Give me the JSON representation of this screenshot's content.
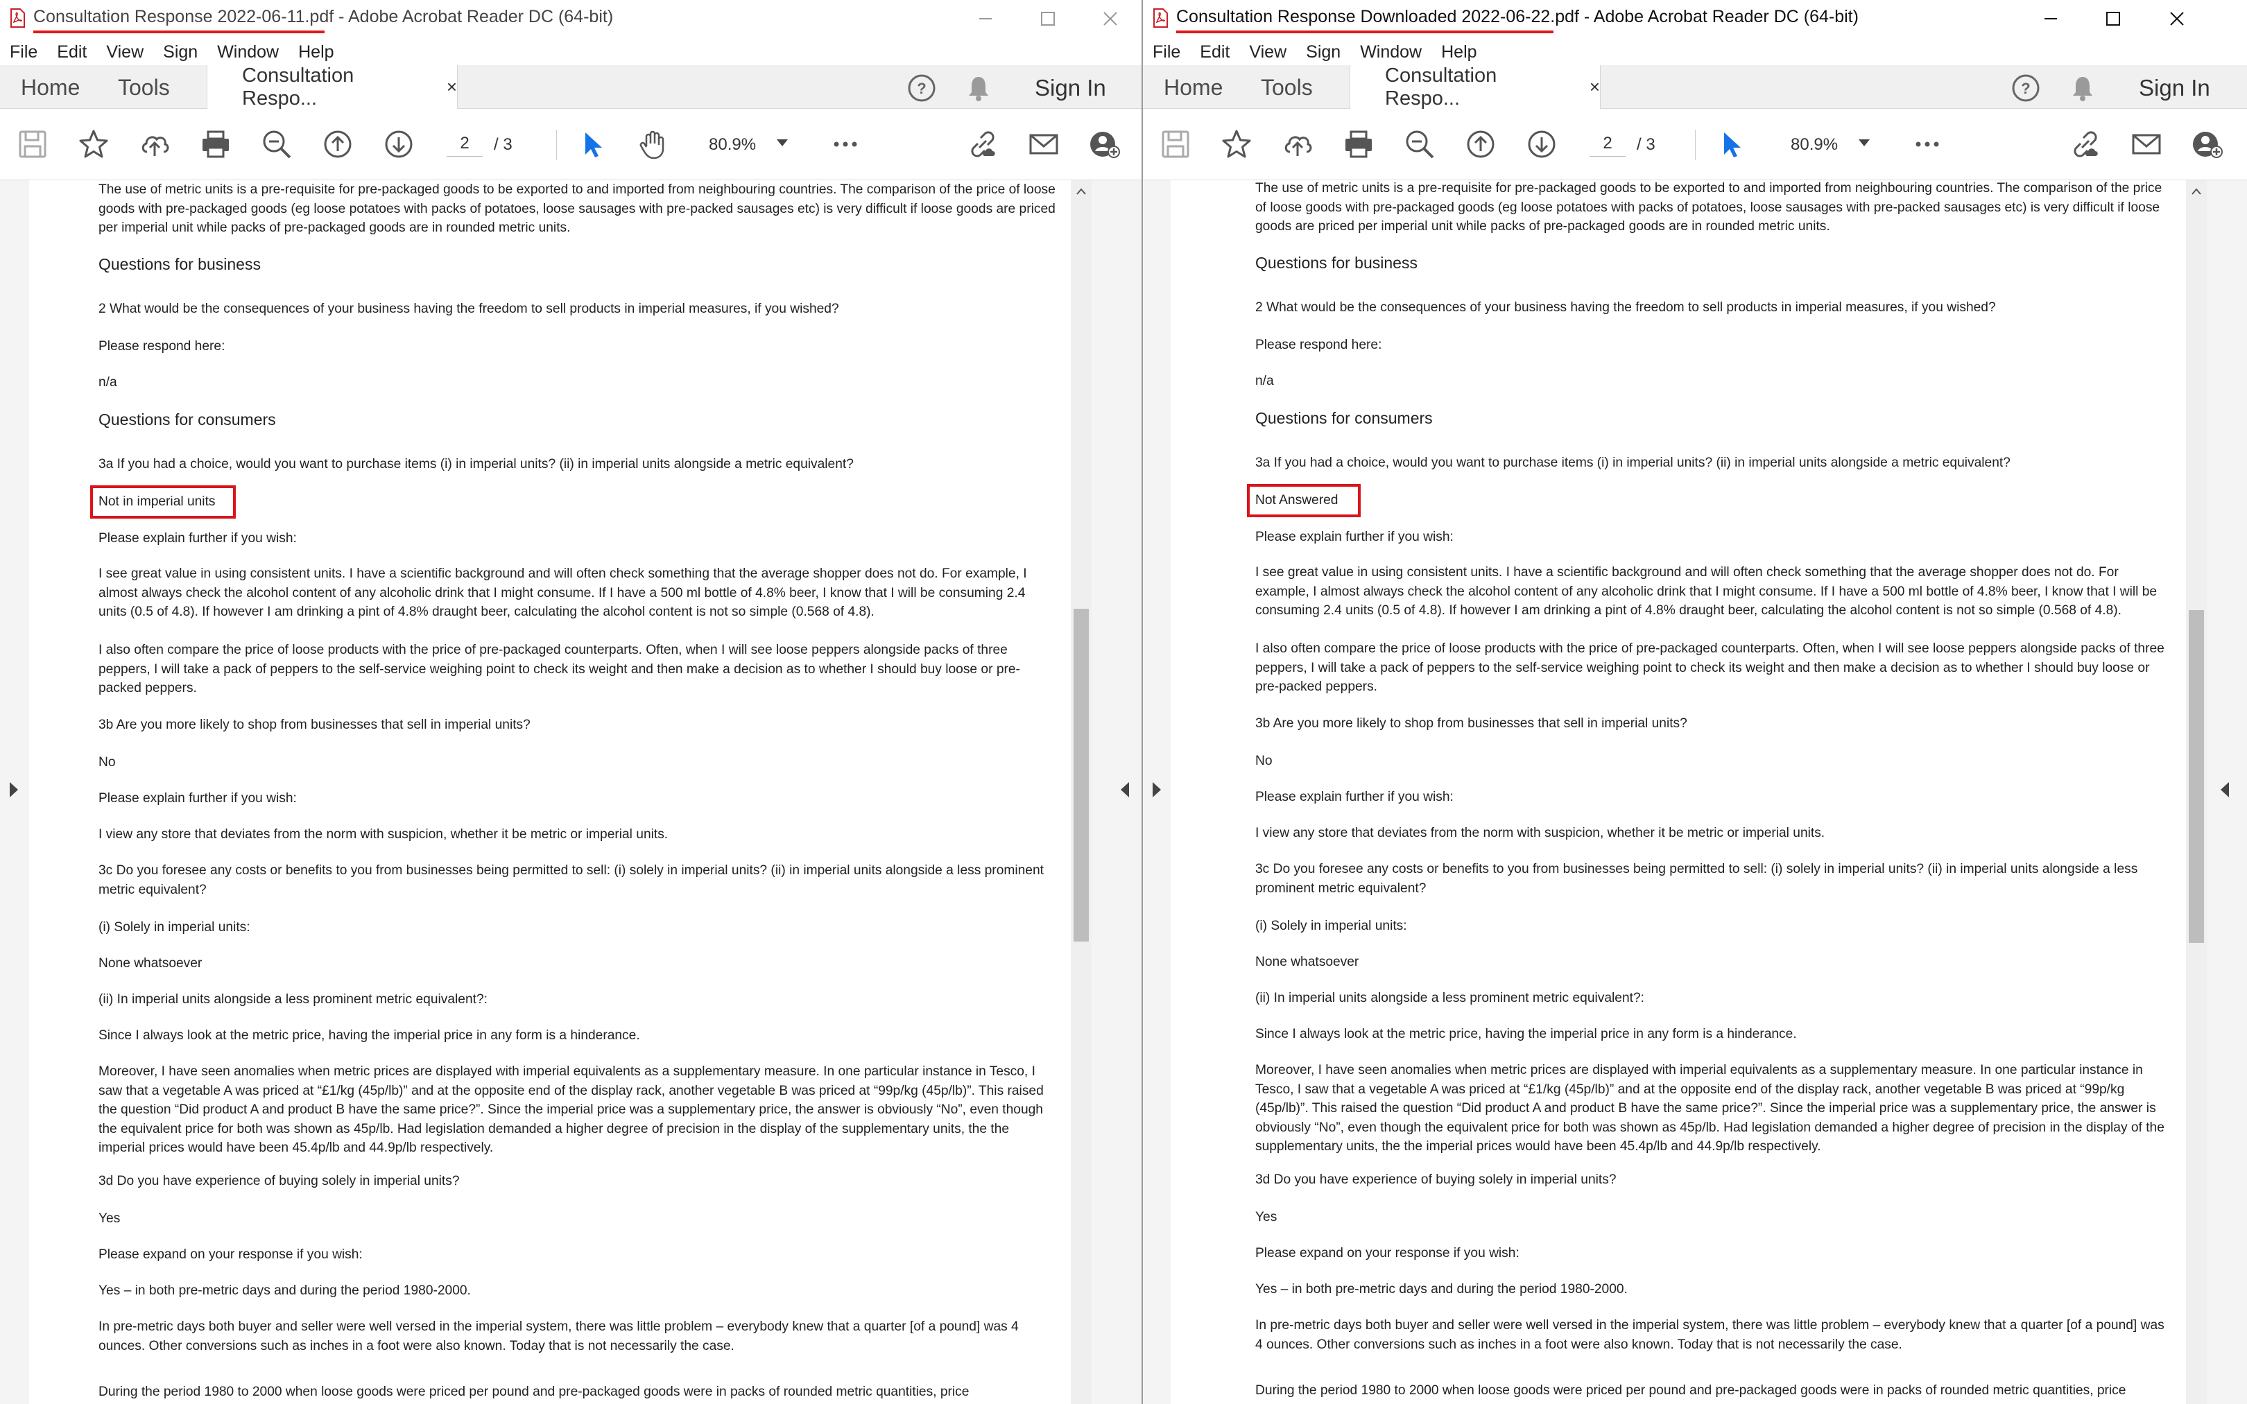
{
  "left_window": {
    "title": "Consultation Response 2022-06-11.pdf - Adobe Acrobat Reader DC (64-bit)",
    "tab_label": "Consultation Respo...",
    "page_current": "2",
    "page_total": "/ 3",
    "zoom": "80.9%",
    "highlighted_answer": "Not in imperial units"
  },
  "right_window": {
    "title": "Consultation Response Downloaded 2022-06-22.pdf - Adobe Acrobat Reader DC (64-bit)",
    "tab_label": "Consultation Respo...",
    "page_current": "2",
    "page_total": "/ 3",
    "zoom": "80.9%",
    "highlighted_answer": "Not Answered"
  },
  "menu": [
    "File",
    "Edit",
    "View",
    "Sign",
    "Window",
    "Help"
  ],
  "nav": {
    "home": "Home",
    "tools": "Tools",
    "sign_in": "Sign In",
    "close": "×"
  },
  "colors": {
    "highlight": "#d9151b",
    "accent_blue": "#1473e6"
  },
  "document": {
    "intro": "The use of metric units is a pre-requisite for pre-packaged goods to be exported to and imported from neighbouring countries. The comparison of the price of loose goods with pre-packaged goods (eg loose potatoes with packs of potatoes, loose sausages with pre-packed sausages etc) is very difficult if loose goods are priced per imperial unit while packs of pre-packaged goods are in rounded metric units.",
    "h_business": "Questions for business",
    "q2": "2  What would be the consequences of your business having the freedom to sell products in imperial measures, if you wished?",
    "respond_here": "Please respond here:",
    "na": "n/a",
    "h_consumers": "Questions for consumers",
    "q3a": "3a  If you had a choice, would you want to purchase items (i) in imperial units? (ii) in imperial units alongside a metric equivalent?",
    "explain": "Please explain further if you wish:",
    "p3a1": "I see great value in using consistent units. I have a scientific background and will often check something that the average shopper does not do. For example, I almost always check the alcohol content of any alcoholic drink that I might consume. If I have a 500 ml bottle of 4.8% beer, I know that I will be consuming 2.4 units (0.5 of 4.8). If however I am drinking a pint of 4.8% draught beer, calculating the alcohol content is not so simple (0.568 of 4.8).",
    "p3a2": "I also often compare the price of loose products with the price of pre-packaged counterparts. Often, when I will see loose peppers alongside packs of three peppers, I will take a pack of peppers to the self-service weighing point to check its weight and then make a decision as to whether I should buy loose or pre-packed peppers.",
    "q3b": "3b  Are you more likely to shop from businesses that sell in imperial units?",
    "a3b": "No",
    "explain2": "Please explain further if you wish:",
    "p3b": "I view any store that deviates from the norm with suspicion, whether it be metric or imperial units.",
    "q3c": "3c  Do you foresee any costs or benefits to you from businesses being permitted to sell: (i) solely in imperial units? (ii) in imperial units alongside a less prominent metric equivalent?",
    "solely": "(i) Solely in imperial units:",
    "none": "None whatsoever",
    "alongside": "(ii) In imperial units alongside a less prominent metric equivalent?:",
    "p3c1": "Since I always look at the metric price, having the imperial price in any form is a hinderance.",
    "p3c2": "Moreover, I have seen anomalies when metric prices are displayed with imperial equivalents as a supplementary measure. In one particular instance in Tesco, I saw that a vegetable A was priced at “£1/kg (45p/lb)” and at the opposite end of the display rack, another vegetable B was priced at “99p/kg (45p/lb)”. This raised the question “Did product A and product B have the same price?”. Since the imperial price was a supplementary price, the answer is obviously “No”, even though the equivalent price for both was shown as 45p/lb. Had legislation demanded a higher degree of precision in the display of the supplementary units, the the imperial prices would have been 45.4p/lb and 44.9p/lb respectively.",
    "q3d": "3d  Do you have experience of buying solely in imperial units?",
    "a3d": "Yes",
    "expand": "Please expand on your response if you wish:",
    "p3d1": "Yes – in both pre-metric days and during the period 1980-2000.",
    "p3d2": "In pre-metric days both buyer and seller were well versed in the imperial system, there was little problem – everybody knew that a quarter [of a pound] was 4 ounces. Other conversions such as inches in a foot were also known. Today that is not necessarily the case.",
    "p3d3": "During the period 1980 to 2000 when loose goods were priced per pound and pre-packaged goods were in packs of rounded metric quantities, price"
  }
}
